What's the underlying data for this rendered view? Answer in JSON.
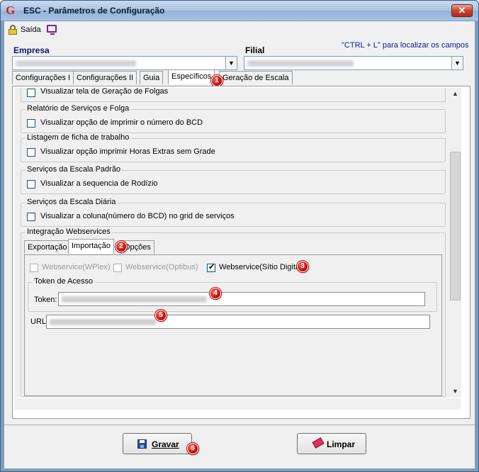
{
  "window": {
    "title": "ESC - Parâmetros de Configuração",
    "logo": "G",
    "close_label": "✕"
  },
  "menu": {
    "saida_label": "Saída",
    "hint": "\"CTRL + L\" para localizar os campos"
  },
  "fields": {
    "empresa_label": "Empresa",
    "filial_label": "Filial"
  },
  "tabs": [
    {
      "label": "Configurações I"
    },
    {
      "label": "Configurações II"
    },
    {
      "label": "Guia"
    },
    {
      "label": "Específicos"
    },
    {
      "label": "Geração de Escala"
    }
  ],
  "specific": {
    "partial_item": "Visualizar tela de Geração de Folgas",
    "groups": [
      {
        "title": "Relatório de Serviços e Folga",
        "option": "Visualizar opção de imprimir o número do BCD",
        "checked": false
      },
      {
        "title": "Listagem de ficha de trabalho",
        "option": "Visualizar opção imprimir Horas Extras sem Grade",
        "checked": false
      },
      {
        "title": "Serviços da Escala Padrão",
        "option": "Visualizar a sequencia de Rodízio",
        "checked": false
      },
      {
        "title": "Serviços da Escala Diária",
        "option": "Visualizar a coluna(número do BCD) no grid de serviços",
        "checked": false
      }
    ],
    "integration": {
      "title": "Integração Webservices",
      "subtabs": [
        "Exportação",
        "Importação",
        "Opções"
      ],
      "options": [
        {
          "label": "Webservice(WPlex)",
          "checked": false,
          "enabled": false
        },
        {
          "label": "Webservice(Optibus)",
          "checked": false,
          "enabled": false
        },
        {
          "label": "Webservice(Sítio Digital",
          "checked": true,
          "enabled": true
        }
      ],
      "token_group_title": "Token de Acesso",
      "token_label": "Token:",
      "url_label": "URL"
    }
  },
  "badges": [
    "1",
    "2",
    "3",
    "4",
    "5",
    "6"
  ],
  "buttons": {
    "save_label": "Gravar",
    "clear_label": "Limpar"
  },
  "colors": {
    "badge": "#c80e0e",
    "title_bar": "#a9c3e1",
    "hint_text": "#0a1a99"
  }
}
